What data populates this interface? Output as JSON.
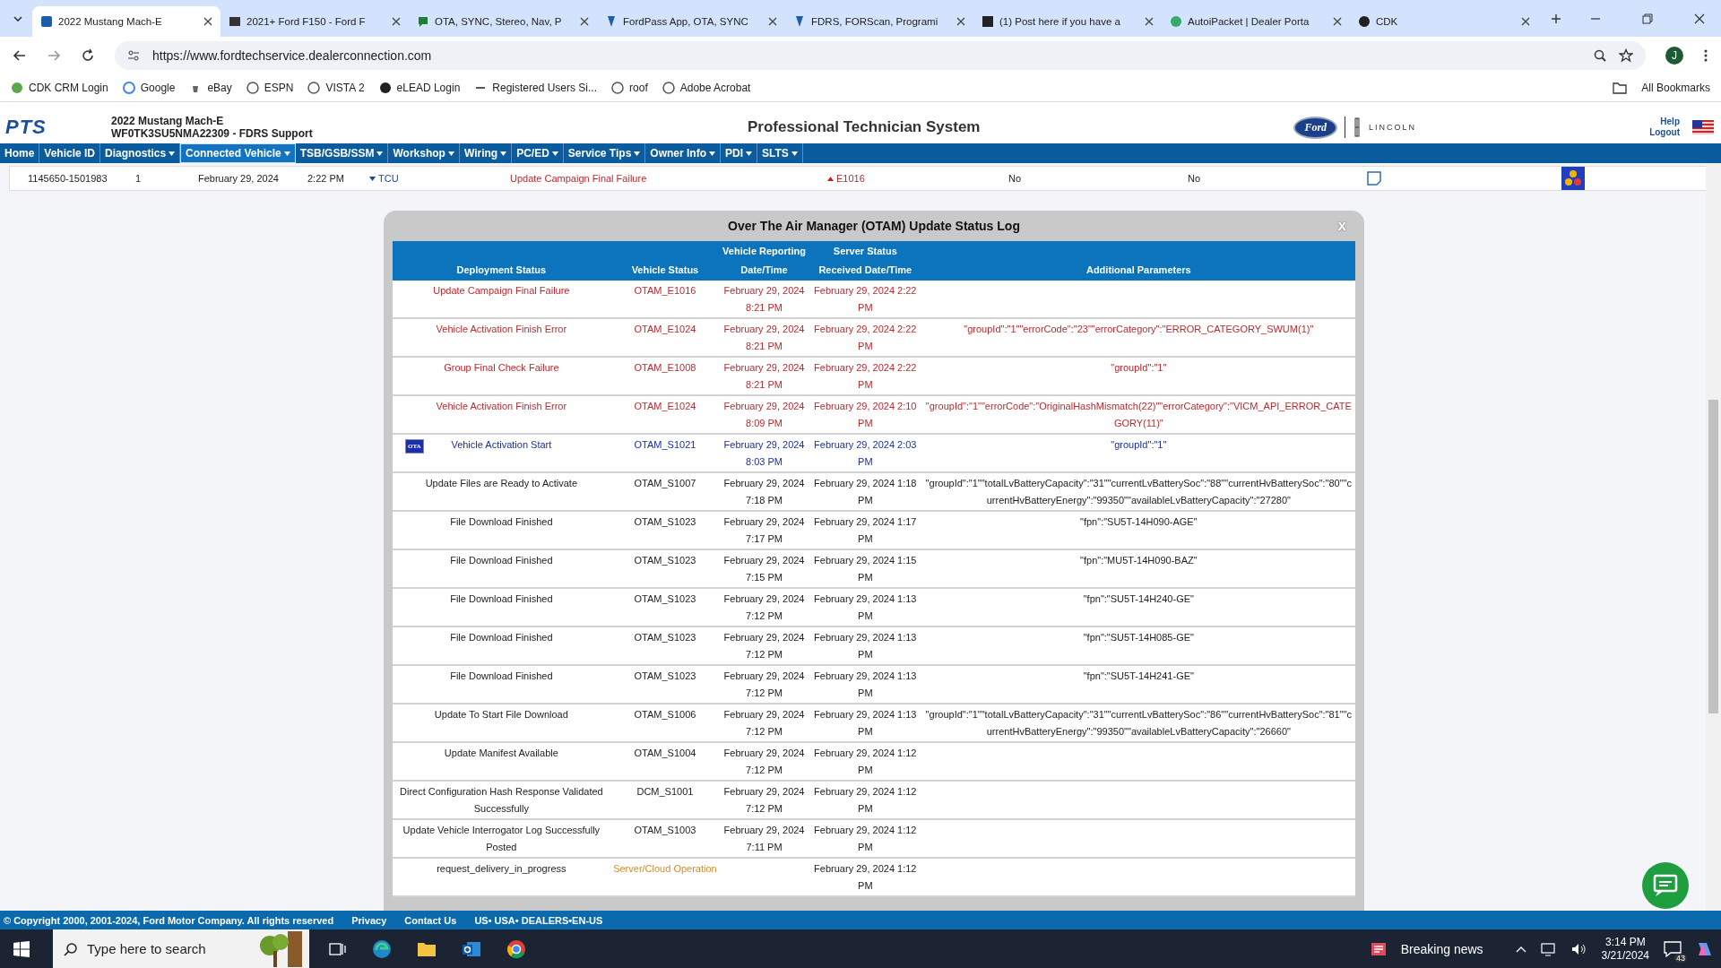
{
  "browser": {
    "tabs": [
      {
        "title": "2022 Mustang Mach-E",
        "selected": true
      },
      {
        "title": "2021+ Ford F150 - Ford F",
        "selected": false
      },
      {
        "title": "OTA, SYNC, Stereo, Nav, P",
        "selected": false
      },
      {
        "title": "FordPass App, OTA, SYNC",
        "selected": false
      },
      {
        "title": "FDRS, FORScan, Programi",
        "selected": false
      },
      {
        "title": "(1) Post here if you have a",
        "selected": false
      },
      {
        "title": "AutoiPacket | Dealer Porta",
        "selected": false
      },
      {
        "title": "CDK",
        "selected": false
      }
    ],
    "url": "https://www.fordtechservice.dealerconnection.com",
    "profile": "J",
    "bookmarks": [
      "CDK CRM Login",
      "Google",
      "eBay",
      "ESPN",
      "VISTA 2",
      "eLEAD Login",
      "Registered Users Si...",
      "roof",
      "Adobe Acrobat"
    ],
    "all_bookmarks": "All Bookmarks"
  },
  "header": {
    "logo": "PTS",
    "vehicle": "2022 Mustang Mach-E",
    "vin": "WF0TK3SU5NMA22309 - FDRS Support",
    "title": "Professional Technician System",
    "ford": "Ford",
    "lincoln": "LINCOLN",
    "help": "Help",
    "logout": "Logout"
  },
  "nav": [
    {
      "label": "Home",
      "dropdown": false,
      "selected": false
    },
    {
      "label": "Vehicle ID",
      "dropdown": false,
      "selected": false
    },
    {
      "label": "Diagnostics",
      "dropdown": true,
      "selected": false
    },
    {
      "label": "Connected Vehicle",
      "dropdown": true,
      "selected": true
    },
    {
      "label": "TSB/GSB/SSM",
      "dropdown": true,
      "selected": false
    },
    {
      "label": "Workshop",
      "dropdown": true,
      "selected": false
    },
    {
      "label": "Wiring",
      "dropdown": true,
      "selected": false
    },
    {
      "label": "PC/ED",
      "dropdown": true,
      "selected": false
    },
    {
      "label": "Service Tips",
      "dropdown": true,
      "selected": false
    },
    {
      "label": "Owner Info",
      "dropdown": true,
      "selected": false
    },
    {
      "label": "PDI",
      "dropdown": true,
      "selected": false
    },
    {
      "label": "SLTS",
      "dropdown": true,
      "selected": false
    }
  ],
  "summary_row": {
    "id": "1145650-1501983",
    "count": "1",
    "date": "February 29, 2024",
    "time": "2:22 PM",
    "module": "TCU",
    "status": "Update Campaign Final Failure",
    "code": "E1016",
    "column_8": "No",
    "column_9": "No"
  },
  "modal": {
    "title": "Over The Air Manager (OTAM) Update Status Log",
    "close": "x",
    "columns": [
      {
        "lines": [
          "Deployment Status"
        ]
      },
      {
        "lines": [
          "Vehicle Status"
        ]
      },
      {
        "lines": [
          "Vehicle Reporting",
          "Date/Time"
        ]
      },
      {
        "lines": [
          "Server Status",
          "Received Date/Time"
        ]
      },
      {
        "lines": [
          "Additional Parameters"
        ]
      }
    ],
    "rows": [
      {
        "kind": "failure",
        "deployment": "Update Campaign Final Failure",
        "vehicle_status": "OTAM_E1016",
        "reported": "February 29, 2024 8:21 PM",
        "received": "February 29, 2024 2:22 PM"
      },
      {
        "kind": "failure",
        "deployment": "Vehicle Activation Finish Error",
        "vehicle_status": "OTAM_E1024",
        "reported": "February 29, 2024 8:21 PM",
        "received": "February 29, 2024 2:22 PM",
        "parameters": "\"groupId\":\"1\"\"errorCode\":\"23\"\"errorCategory\":\"ERROR_CATEGORY_SWUM(1)\""
      },
      {
        "kind": "failure",
        "deployment": "Group Final Check Failure",
        "vehicle_status": "OTAM_E1008",
        "reported": "February 29, 2024 8:21 PM",
        "received": "February 29, 2024 2:22 PM",
        "parameters": "\"groupId\":\"1\""
      },
      {
        "kind": "failure",
        "deployment": "Vehicle Activation Finish Error",
        "vehicle_status": "OTAM_E1024",
        "reported": "February 29, 2024 8:09 PM",
        "received": "February 29, 2024 2:10 PM",
        "parameters": "\"groupId\":\"1\"\"errorCode\":\"OriginalHashMismatch(22)\"\"errorCategory\":\"VICM_API_ERROR_CATEGORY(11)\""
      },
      {
        "kind": "start",
        "badge": "OTA",
        "deployment": "Vehicle Activation Start",
        "vehicle_status": "OTAM_S1021",
        "reported": "February 29, 2024 8:03 PM",
        "received": "February 29, 2024 2:03 PM",
        "parameters": "\"groupId\":\"1\""
      },
      {
        "kind": "progress",
        "deployment": "Update Files are Ready to Activate",
        "vehicle_status": "OTAM_S1007",
        "reported": "February 29, 2024 7:18 PM",
        "received": "February 29, 2024 1:18 PM",
        "parameters": "\"groupId\":\"1\"\"totalLvBatteryCapacity\":\"31\"\"currentLvBatterySoc\":\"88\"\"currentHvBatterySoc\":\"80\"\"currentHvBatteryEnergy\":\"99350\"\"availableLvBatteryCapacity\":\"27280\""
      },
      {
        "kind": "progress",
        "deployment": "File Download Finished",
        "vehicle_status": "OTAM_S1023",
        "reported": "February 29, 2024 7:17 PM",
        "received": "February 29, 2024 1:17 PM",
        "parameters": "\"fpn\":\"SU5T-14H090-AGE\""
      },
      {
        "kind": "progress",
        "deployment": "File Download Finished",
        "vehicle_status": "OTAM_S1023",
        "reported": "February 29, 2024 7:15 PM",
        "received": "February 29, 2024 1:15 PM",
        "parameters": "\"fpn\":\"MU5T-14H090-BAZ\""
      },
      {
        "kind": "progress",
        "deployment": "File Download Finished",
        "vehicle_status": "OTAM_S1023",
        "reported": "February 29, 2024 7:12 PM",
        "received": "February 29, 2024 1:13 PM",
        "parameters": "\"fpn\":\"SU5T-14H240-GE\""
      },
      {
        "kind": "progress",
        "deployment": "File Download Finished",
        "vehicle_status": "OTAM_S1023",
        "reported": "February 29, 2024 7:12 PM",
        "received": "February 29, 2024 1:13 PM",
        "parameters": "\"fpn\":\"SU5T-14H085-GE\""
      },
      {
        "kind": "progress",
        "deployment": "File Download Finished",
        "vehicle_status": "OTAM_S1023",
        "reported": "February 29, 2024 7:12 PM",
        "received": "February 29, 2024 1:13 PM",
        "parameters": "\"fpn\":\"SU5T-14H241-GE\""
      },
      {
        "kind": "progress",
        "deployment": "Update To Start File Download",
        "vehicle_status": "OTAM_S1006",
        "reported": "February 29, 2024 7:12 PM",
        "received": "February 29, 2024 1:13 PM",
        "parameters": "\"groupId\":\"1\"\"totalLvBatteryCapacity\":\"31\"\"currentLvBatterySoc\":\"86\"\"currentHvBatterySoc\":\"81\"\"currentHvBatteryEnergy\":\"99350\"\"availableLvBatteryCapacity\":\"26660\""
      },
      {
        "kind": "progress",
        "deployment": "Update Manifest Available",
        "vehicle_status": "OTAM_S1004",
        "reported": "February 29, 2024 7:12 PM",
        "received": "February 29, 2024 1:12 PM"
      },
      {
        "kind": "progress",
        "deployment": "Direct Configuration Hash Response Validated Successfully",
        "vehicle_status": "DCM_S1001",
        "reported": "February 29, 2024 7:12 PM",
        "received": "February 29, 2024 1:12 PM"
      },
      {
        "kind": "progress",
        "deployment": "Update Vehicle Interrogator Log Successfully Posted",
        "vehicle_status": "OTAM_S1003",
        "reported": "February 29, 2024 7:11 PM",
        "received": "February 29, 2024 1:12 PM"
      },
      {
        "kind": "cloud",
        "deployment": "request_delivery_in_progress",
        "vehicle_status": "Server/Cloud Operation",
        "received": "February 29, 2024 1:12 PM"
      }
    ]
  },
  "footer": {
    "copyright": "© Copyright 2000, 2001-2024, Ford Motor Company. All rights reserved",
    "links": [
      "Privacy",
      "Contact Us"
    ],
    "locale": "US• USA• DEALERS•EN-US"
  },
  "taskbar": {
    "search": "Type here to search",
    "news": "Breaking news",
    "time": "3:14 PM",
    "date": "3/21/2024",
    "notifications": "43"
  }
}
